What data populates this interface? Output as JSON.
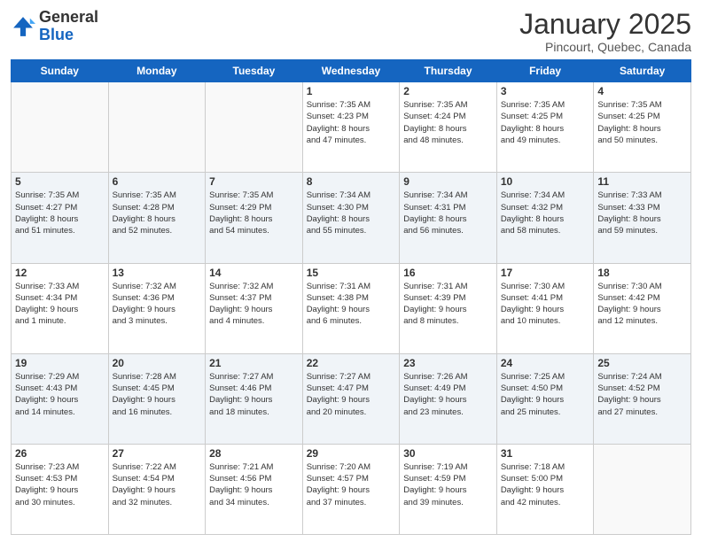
{
  "header": {
    "logo_general": "General",
    "logo_blue": "Blue",
    "month_title": "January 2025",
    "subtitle": "Pincourt, Quebec, Canada"
  },
  "weekdays": [
    "Sunday",
    "Monday",
    "Tuesday",
    "Wednesday",
    "Thursday",
    "Friday",
    "Saturday"
  ],
  "weeks": [
    [
      {
        "day": "",
        "info": ""
      },
      {
        "day": "",
        "info": ""
      },
      {
        "day": "",
        "info": ""
      },
      {
        "day": "1",
        "info": "Sunrise: 7:35 AM\nSunset: 4:23 PM\nDaylight: 8 hours\nand 47 minutes."
      },
      {
        "day": "2",
        "info": "Sunrise: 7:35 AM\nSunset: 4:24 PM\nDaylight: 8 hours\nand 48 minutes."
      },
      {
        "day": "3",
        "info": "Sunrise: 7:35 AM\nSunset: 4:25 PM\nDaylight: 8 hours\nand 49 minutes."
      },
      {
        "day": "4",
        "info": "Sunrise: 7:35 AM\nSunset: 4:25 PM\nDaylight: 8 hours\nand 50 minutes."
      }
    ],
    [
      {
        "day": "5",
        "info": "Sunrise: 7:35 AM\nSunset: 4:27 PM\nDaylight: 8 hours\nand 51 minutes."
      },
      {
        "day": "6",
        "info": "Sunrise: 7:35 AM\nSunset: 4:28 PM\nDaylight: 8 hours\nand 52 minutes."
      },
      {
        "day": "7",
        "info": "Sunrise: 7:35 AM\nSunset: 4:29 PM\nDaylight: 8 hours\nand 54 minutes."
      },
      {
        "day": "8",
        "info": "Sunrise: 7:34 AM\nSunset: 4:30 PM\nDaylight: 8 hours\nand 55 minutes."
      },
      {
        "day": "9",
        "info": "Sunrise: 7:34 AM\nSunset: 4:31 PM\nDaylight: 8 hours\nand 56 minutes."
      },
      {
        "day": "10",
        "info": "Sunrise: 7:34 AM\nSunset: 4:32 PM\nDaylight: 8 hours\nand 58 minutes."
      },
      {
        "day": "11",
        "info": "Sunrise: 7:33 AM\nSunset: 4:33 PM\nDaylight: 8 hours\nand 59 minutes."
      }
    ],
    [
      {
        "day": "12",
        "info": "Sunrise: 7:33 AM\nSunset: 4:34 PM\nDaylight: 9 hours\nand 1 minute."
      },
      {
        "day": "13",
        "info": "Sunrise: 7:32 AM\nSunset: 4:36 PM\nDaylight: 9 hours\nand 3 minutes."
      },
      {
        "day": "14",
        "info": "Sunrise: 7:32 AM\nSunset: 4:37 PM\nDaylight: 9 hours\nand 4 minutes."
      },
      {
        "day": "15",
        "info": "Sunrise: 7:31 AM\nSunset: 4:38 PM\nDaylight: 9 hours\nand 6 minutes."
      },
      {
        "day": "16",
        "info": "Sunrise: 7:31 AM\nSunset: 4:39 PM\nDaylight: 9 hours\nand 8 minutes."
      },
      {
        "day": "17",
        "info": "Sunrise: 7:30 AM\nSunset: 4:41 PM\nDaylight: 9 hours\nand 10 minutes."
      },
      {
        "day": "18",
        "info": "Sunrise: 7:30 AM\nSunset: 4:42 PM\nDaylight: 9 hours\nand 12 minutes."
      }
    ],
    [
      {
        "day": "19",
        "info": "Sunrise: 7:29 AM\nSunset: 4:43 PM\nDaylight: 9 hours\nand 14 minutes."
      },
      {
        "day": "20",
        "info": "Sunrise: 7:28 AM\nSunset: 4:45 PM\nDaylight: 9 hours\nand 16 minutes."
      },
      {
        "day": "21",
        "info": "Sunrise: 7:27 AM\nSunset: 4:46 PM\nDaylight: 9 hours\nand 18 minutes."
      },
      {
        "day": "22",
        "info": "Sunrise: 7:27 AM\nSunset: 4:47 PM\nDaylight: 9 hours\nand 20 minutes."
      },
      {
        "day": "23",
        "info": "Sunrise: 7:26 AM\nSunset: 4:49 PM\nDaylight: 9 hours\nand 23 minutes."
      },
      {
        "day": "24",
        "info": "Sunrise: 7:25 AM\nSunset: 4:50 PM\nDaylight: 9 hours\nand 25 minutes."
      },
      {
        "day": "25",
        "info": "Sunrise: 7:24 AM\nSunset: 4:52 PM\nDaylight: 9 hours\nand 27 minutes."
      }
    ],
    [
      {
        "day": "26",
        "info": "Sunrise: 7:23 AM\nSunset: 4:53 PM\nDaylight: 9 hours\nand 30 minutes."
      },
      {
        "day": "27",
        "info": "Sunrise: 7:22 AM\nSunset: 4:54 PM\nDaylight: 9 hours\nand 32 minutes."
      },
      {
        "day": "28",
        "info": "Sunrise: 7:21 AM\nSunset: 4:56 PM\nDaylight: 9 hours\nand 34 minutes."
      },
      {
        "day": "29",
        "info": "Sunrise: 7:20 AM\nSunset: 4:57 PM\nDaylight: 9 hours\nand 37 minutes."
      },
      {
        "day": "30",
        "info": "Sunrise: 7:19 AM\nSunset: 4:59 PM\nDaylight: 9 hours\nand 39 minutes."
      },
      {
        "day": "31",
        "info": "Sunrise: 7:18 AM\nSunset: 5:00 PM\nDaylight: 9 hours\nand 42 minutes."
      },
      {
        "day": "",
        "info": ""
      }
    ]
  ]
}
